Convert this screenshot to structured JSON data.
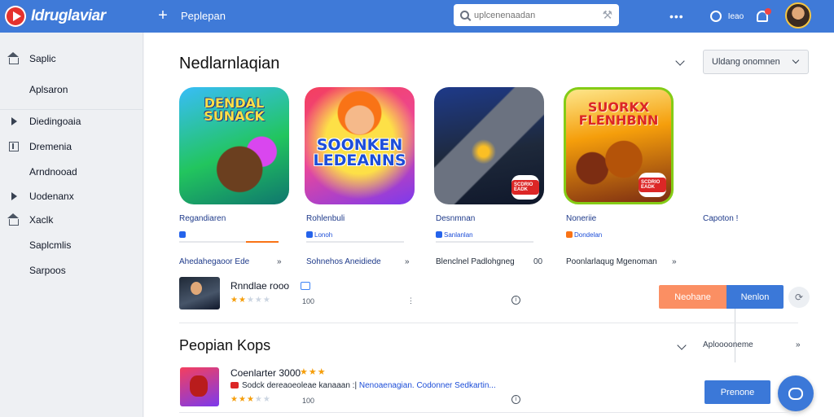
{
  "header": {
    "logo_text": "Idruglaviar",
    "plus_label": "+",
    "nav_link": "Peplepan",
    "search_placeholder": "uplcenenaadan",
    "more_label": "•••",
    "chat_label": "Ieao",
    "colors": {
      "bar": "#3f7ad8",
      "logo": "#e5322d"
    }
  },
  "sidebar": {
    "items": [
      {
        "label": "Saplic",
        "icon": "home-icon"
      },
      {
        "label": "Aplsaron",
        "icon": ""
      },
      {
        "label": "Diedingoaia",
        "icon": "play-icon"
      },
      {
        "label": "Dremenia",
        "icon": "box-icon"
      },
      {
        "label": "Arndnooad",
        "icon": ""
      },
      {
        "label": "Uodenanx",
        "icon": "play-icon"
      },
      {
        "label": "Xaclk",
        "icon": "home-icon"
      },
      {
        "label": "Saplcmlis",
        "icon": ""
      },
      {
        "label": "Sarpoos",
        "icon": ""
      }
    ]
  },
  "section1": {
    "title": "Nedlarnlaqian",
    "dropdown_value": "Uldang onomnen",
    "cards": [
      {
        "art_title": "DENDAL SUNACK",
        "name": "Regandiaren",
        "meta": "",
        "sub": "Ahedahegaoor Ede",
        "arrow": "»"
      },
      {
        "art_title": "SOONKEN LEDEANNS",
        "name": "Rohlenbuli",
        "meta": "Lonoh",
        "sub": "Sohnehos Aneidiede",
        "arrow": "»"
      },
      {
        "art_title": "",
        "badge": "SCDRIO EADK",
        "name": "Desnmnan",
        "meta": "Sanlanlan",
        "sub": "Blenclnel Padlohgneg",
        "arrow": "00"
      },
      {
        "art_title": "SUORKX FLENHBNN",
        "badge": "SCDRIO EADK",
        "name": "Noneriie",
        "meta": "Dondelan",
        "sub": "Poonlarlaqug Mgenoman",
        "arrow": "»"
      },
      {
        "name": "Capoton !"
      }
    ],
    "featured": {
      "title": "Rnndlae rooo",
      "rating": 2,
      "rating_max": 5,
      "count": "100",
      "more": "⋮",
      "info": "i"
    },
    "buttons": {
      "secondary": "Neohane",
      "primary": "Nenlon",
      "icon_btn": "⟳"
    }
  },
  "section2": {
    "title": "Peopian Kops",
    "side_link": "Aplooooneme",
    "side_arrow": "»",
    "row": {
      "title": "Coenlarter 3000",
      "title_stars": "★★★",
      "desc_prefix": "Sodck dereaoeoleae kanaaan",
      "desc_sep": ":|",
      "desc_highlight": "Nenoaenagian. Codonner Sedkartin...",
      "rating": 3,
      "rating_max": 5,
      "count": "100",
      "info": "i"
    },
    "button_primary": "Prenone"
  }
}
